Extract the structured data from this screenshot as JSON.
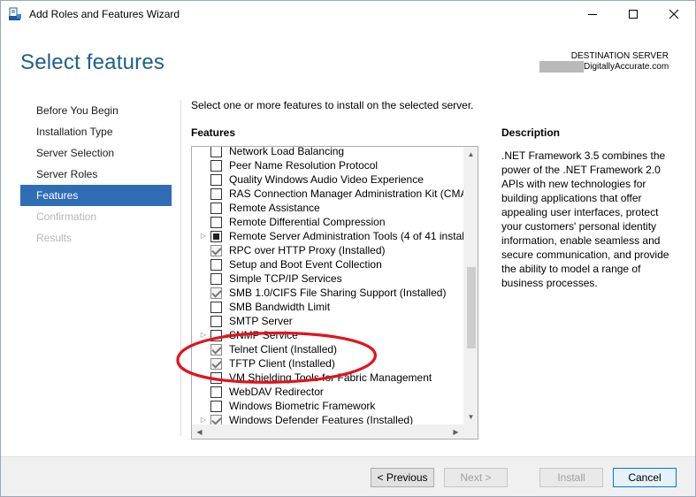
{
  "window": {
    "title": "Add Roles and Features Wizard"
  },
  "header": {
    "title": "Select features",
    "destination_label": "DESTINATION SERVER",
    "destination_name": "DigitallyAccurate.com"
  },
  "nav": {
    "items": [
      {
        "label": "Before You Begin",
        "state": "normal"
      },
      {
        "label": "Installation Type",
        "state": "normal"
      },
      {
        "label": "Server Selection",
        "state": "normal"
      },
      {
        "label": "Server Roles",
        "state": "normal"
      },
      {
        "label": "Features",
        "state": "active"
      },
      {
        "label": "Confirmation",
        "state": "disabled"
      },
      {
        "label": "Results",
        "state": "disabled"
      }
    ]
  },
  "main": {
    "instruction": "Select one or more features to install on the selected server.",
    "features_label": "Features",
    "features": [
      {
        "label": "Network Load Balancing",
        "state": "unchecked",
        "expander": false
      },
      {
        "label": "Peer Name Resolution Protocol",
        "state": "unchecked",
        "expander": false
      },
      {
        "label": "Quality Windows Audio Video Experience",
        "state": "unchecked",
        "expander": false
      },
      {
        "label": "RAS Connection Manager Administration Kit (CMA",
        "state": "unchecked",
        "expander": false
      },
      {
        "label": "Remote Assistance",
        "state": "unchecked",
        "expander": false
      },
      {
        "label": "Remote Differential Compression",
        "state": "unchecked",
        "expander": false
      },
      {
        "label": "Remote Server Administration Tools (4 of 41 instal",
        "state": "partial",
        "expander": true
      },
      {
        "label": "RPC over HTTP Proxy (Installed)",
        "state": "checked",
        "expander": false
      },
      {
        "label": "Setup and Boot Event Collection",
        "state": "unchecked",
        "expander": false
      },
      {
        "label": "Simple TCP/IP Services",
        "state": "unchecked",
        "expander": false
      },
      {
        "label": "SMB 1.0/CIFS File Sharing Support (Installed)",
        "state": "checked",
        "expander": false
      },
      {
        "label": "SMB Bandwidth Limit",
        "state": "unchecked",
        "expander": false
      },
      {
        "label": "SMTP Server",
        "state": "unchecked",
        "expander": false
      },
      {
        "label": "SNMP Service",
        "state": "unchecked",
        "expander": true
      },
      {
        "label": "Telnet Client (Installed)",
        "state": "checked",
        "expander": false
      },
      {
        "label": "TFTP Client (Installed)",
        "state": "checked",
        "expander": false
      },
      {
        "label": "VM Shielding Tools for Fabric Management",
        "state": "unchecked",
        "expander": false
      },
      {
        "label": "WebDAV Redirector",
        "state": "unchecked",
        "expander": false
      },
      {
        "label": "Windows Biometric Framework",
        "state": "unchecked",
        "expander": false
      },
      {
        "label": "Windows Defender Features (Installed)",
        "state": "checked",
        "expander": true
      }
    ]
  },
  "description": {
    "label": "Description",
    "text": ".NET Framework 3.5 combines the power of the .NET Framework 2.0 APIs with new technologies for building applications that offer appealing user interfaces, protect your customers' personal identity information, enable seamless and secure communication, and provide the ability to model a range of business processes."
  },
  "footer": {
    "previous_label": "< Previous",
    "next_label": "Next >",
    "install_label": "Install",
    "cancel_label": "Cancel"
  },
  "colors": {
    "header_title": "#1e5e8a",
    "nav_active_bg": "#2f6db4",
    "annotation_red": "#e0141e"
  },
  "icons": [
    "wizard-app-icon",
    "minimize-icon",
    "maximize-icon",
    "close-icon",
    "expander-arrow-icon",
    "scroll-up-icon",
    "scroll-down-icon",
    "scroll-left-icon",
    "scroll-right-icon"
  ]
}
